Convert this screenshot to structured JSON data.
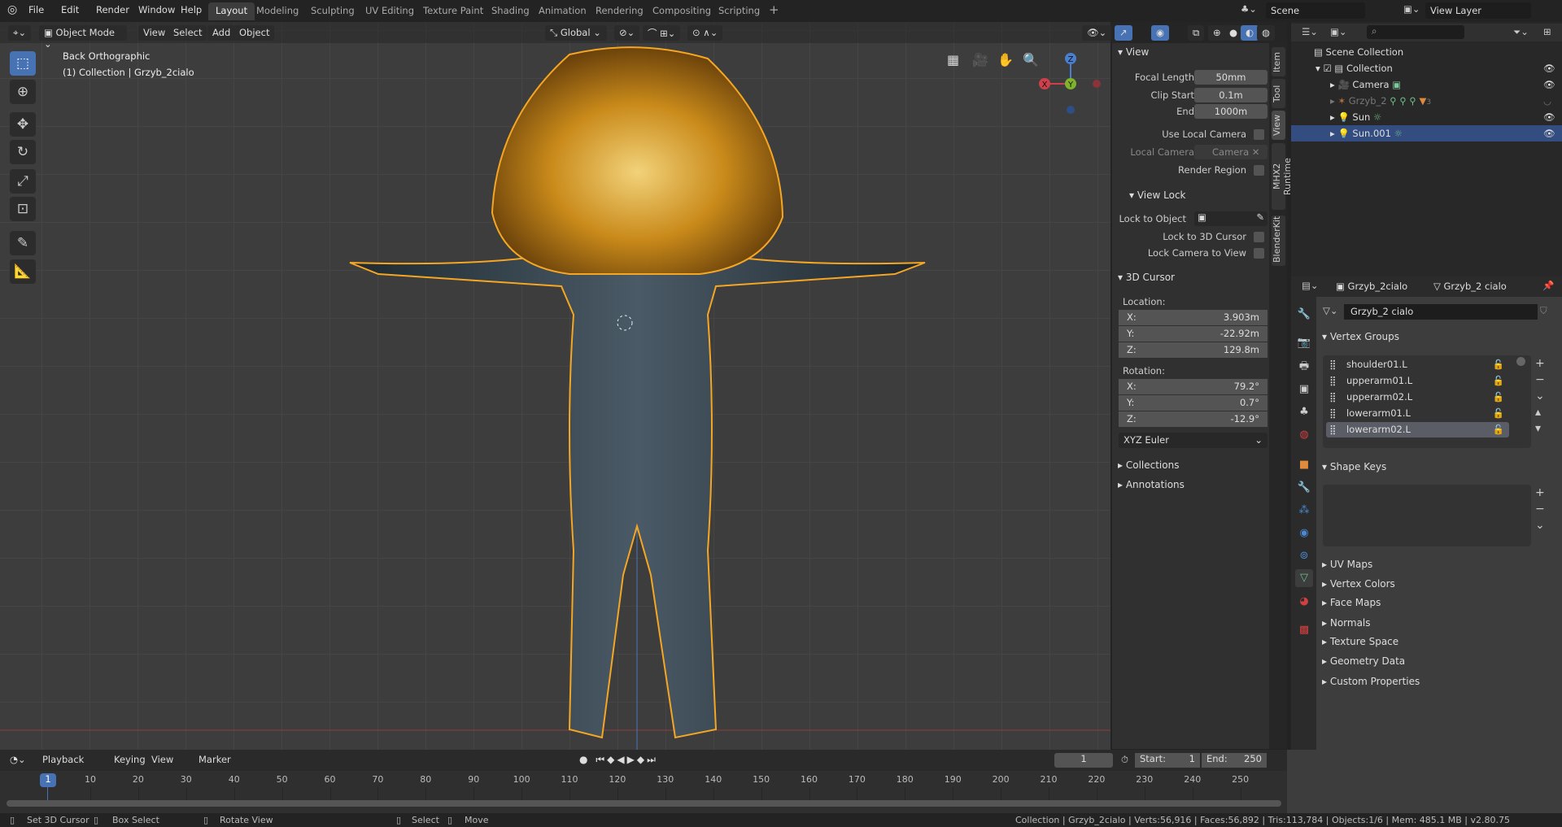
{
  "menu": [
    "File",
    "Edit",
    "Render",
    "Window",
    "Help"
  ],
  "workspaces": [
    "Layout",
    "Modeling",
    "Sculpting",
    "UV Editing",
    "Texture Paint",
    "Shading",
    "Animation",
    "Rendering",
    "Compositing",
    "Scripting"
  ],
  "active_workspace": "Layout",
  "scene": "Scene",
  "view_layer": "View Layer",
  "viewport_header": {
    "mode": "Object Mode",
    "menus": [
      "View",
      "Select",
      "Add",
      "Object"
    ],
    "orientation": "Global"
  },
  "viewport": {
    "view_name": "Back Orthographic",
    "collection_info": "(1) Collection | Grzyb_2cialo",
    "gizmo": {
      "x": "X",
      "y": "Y",
      "z": "Z"
    }
  },
  "sidebar_tabs": [
    "Item",
    "Tool",
    "View",
    "MHX2 Runtime",
    "BlenderKit"
  ],
  "view_panel": {
    "title": "View",
    "focal_length_label": "Focal Length",
    "focal_length": "50mm",
    "clip_start_label": "Clip Start",
    "clip_start": "0.1m",
    "end_label": "End",
    "end": "1000m",
    "use_local_camera": "Use Local Camera",
    "local_camera_label": "Local Camera",
    "local_camera": "Camera",
    "render_region": "Render Region",
    "view_lock": "View Lock",
    "lock_to_object": "Lock to Object",
    "lock_3d_cursor": "Lock to 3D Cursor",
    "lock_camera": "Lock Camera to View"
  },
  "cursor_panel": {
    "title": "3D Cursor",
    "location": "Location:",
    "loc": [
      {
        "axis": "X:",
        "value": "3.903m"
      },
      {
        "axis": "Y:",
        "value": "-22.92m"
      },
      {
        "axis": "Z:",
        "value": "129.8m"
      }
    ],
    "rotation": "Rotation:",
    "rot": [
      {
        "axis": "X:",
        "value": "79.2°"
      },
      {
        "axis": "Y:",
        "value": "0.7°"
      },
      {
        "axis": "Z:",
        "value": "-12.9°"
      }
    ],
    "mode": "XYZ Euler"
  },
  "collapsed_panels": [
    "Collections",
    "Annotations"
  ],
  "outliner": {
    "root": "Scene Collection",
    "items": [
      "Collection",
      "Camera",
      "Grzyb_2",
      "Sun",
      "Sun.001"
    ],
    "selected": "Sun.001",
    "badge": "3"
  },
  "properties": {
    "object": "Grzyb_2cialo",
    "mesh": "Grzyb_2 cialo",
    "mesh_field": "Grzyb_2 cialo",
    "vertex_groups_title": "Vertex Groups",
    "vertex_groups": [
      "shoulder01.L",
      "upperarm01.L",
      "upperarm02.L",
      "lowerarm01.L",
      "lowerarm02.L"
    ],
    "shape_keys_title": "Shape Keys",
    "sections": [
      "UV Maps",
      "Vertex Colors",
      "Face Maps",
      "Normals",
      "Texture Space",
      "Geometry Data",
      "Custom Properties"
    ]
  },
  "timeline": {
    "menus": [
      "Playback",
      "Keying",
      "View",
      "Marker"
    ],
    "current_frame": "1",
    "start_label": "Start:",
    "start": "1",
    "end_label": "End:",
    "end": "250",
    "ticks": [
      10,
      20,
      30,
      40,
      50,
      60,
      70,
      80,
      90,
      100,
      110,
      120,
      130,
      140,
      150,
      160,
      170,
      180,
      190,
      200,
      210,
      220,
      230,
      240,
      250
    ]
  },
  "status": {
    "left": [
      "Set 3D Cursor",
      "Box Select",
      "Rotate View",
      "Select",
      "Move"
    ],
    "right": "Collection | Grzyb_2cialo | Verts:56,916 | Faces:56,892 | Tris:113,784 | Objects:1/6 | Mem: 485.1 MB | v2.80.75"
  },
  "colors": {
    "accent": "#4772b3",
    "selection_outline": "#f5a623"
  }
}
